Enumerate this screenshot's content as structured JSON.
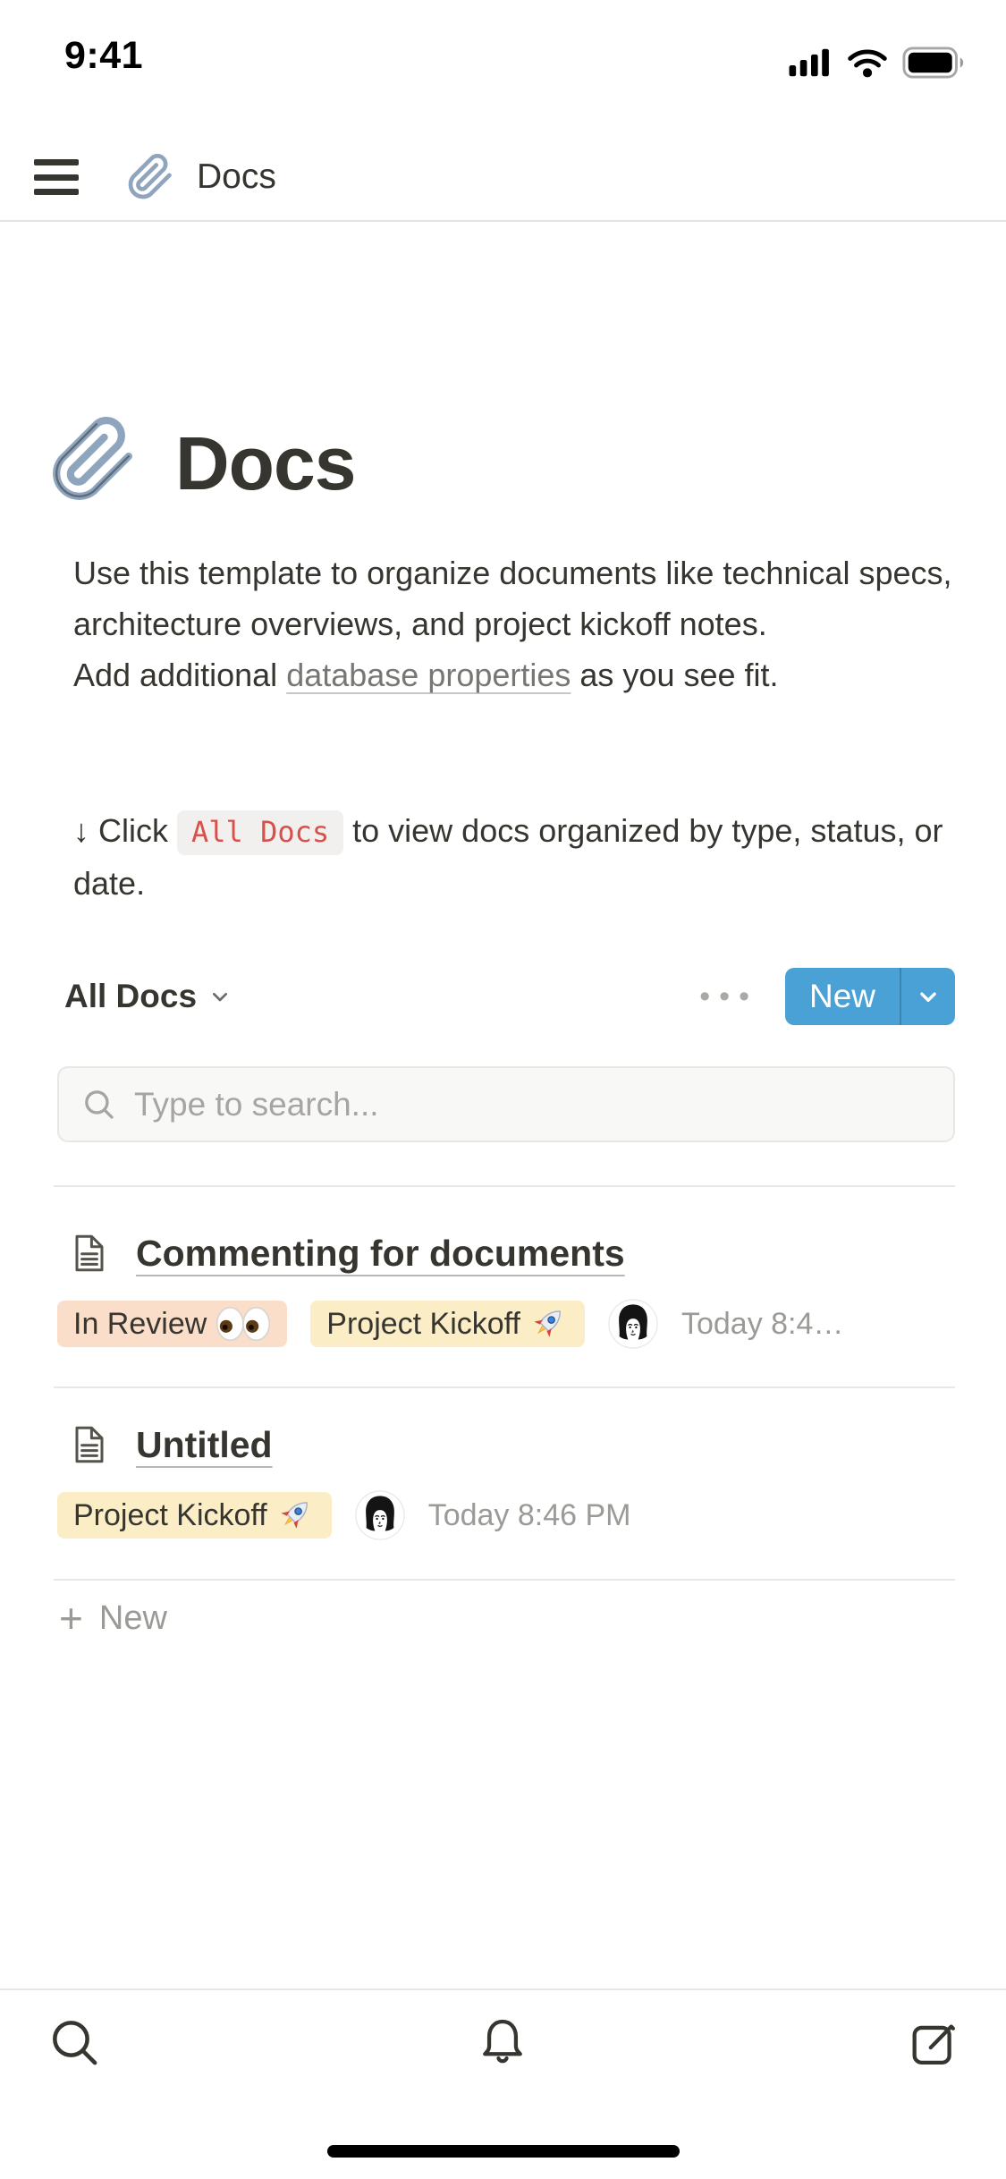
{
  "status_bar": {
    "time": "9:41"
  },
  "header": {
    "title": "Docs"
  },
  "page": {
    "icon": "paperclip-emoji",
    "title": "Docs",
    "description": "Use this template to organize documents like technical specs, architecture overviews, and project kickoff notes.",
    "add_property_prefix": "Add additional ",
    "add_property_link": "database properties",
    "add_property_suffix": " as you see fit.",
    "callout": {
      "arrow": "↓",
      "prefix": "Click",
      "code": "All Docs",
      "suffix": "to view docs organized by type, status, or date."
    }
  },
  "view_bar": {
    "selected_view": "All Docs",
    "more_label": "•••",
    "new_button_label": "New"
  },
  "search": {
    "placeholder": "Type to search..."
  },
  "list": {
    "rows": [
      {
        "title": "Commenting for documents",
        "tags": [
          {
            "label": "In Review",
            "emoji": "eyes"
          },
          {
            "label": "Project Kickoff",
            "emoji": "rocket"
          }
        ],
        "timestamp": "Today 8:4…"
      },
      {
        "title": "Untitled",
        "tags": [
          {
            "label": "Project Kickoff",
            "emoji": "rocket"
          }
        ],
        "timestamp": "Today 8:46 PM"
      }
    ],
    "new_row_plus": "+",
    "new_row_label": "New"
  },
  "colors": {
    "accent_blue": "#49A1D5",
    "code_red": "#D8504A",
    "tag_peach": "#FADEC9",
    "tag_yellow": "#FBEDC6",
    "text_primary": "#37352F",
    "text_secondary": "#9B9A97"
  }
}
